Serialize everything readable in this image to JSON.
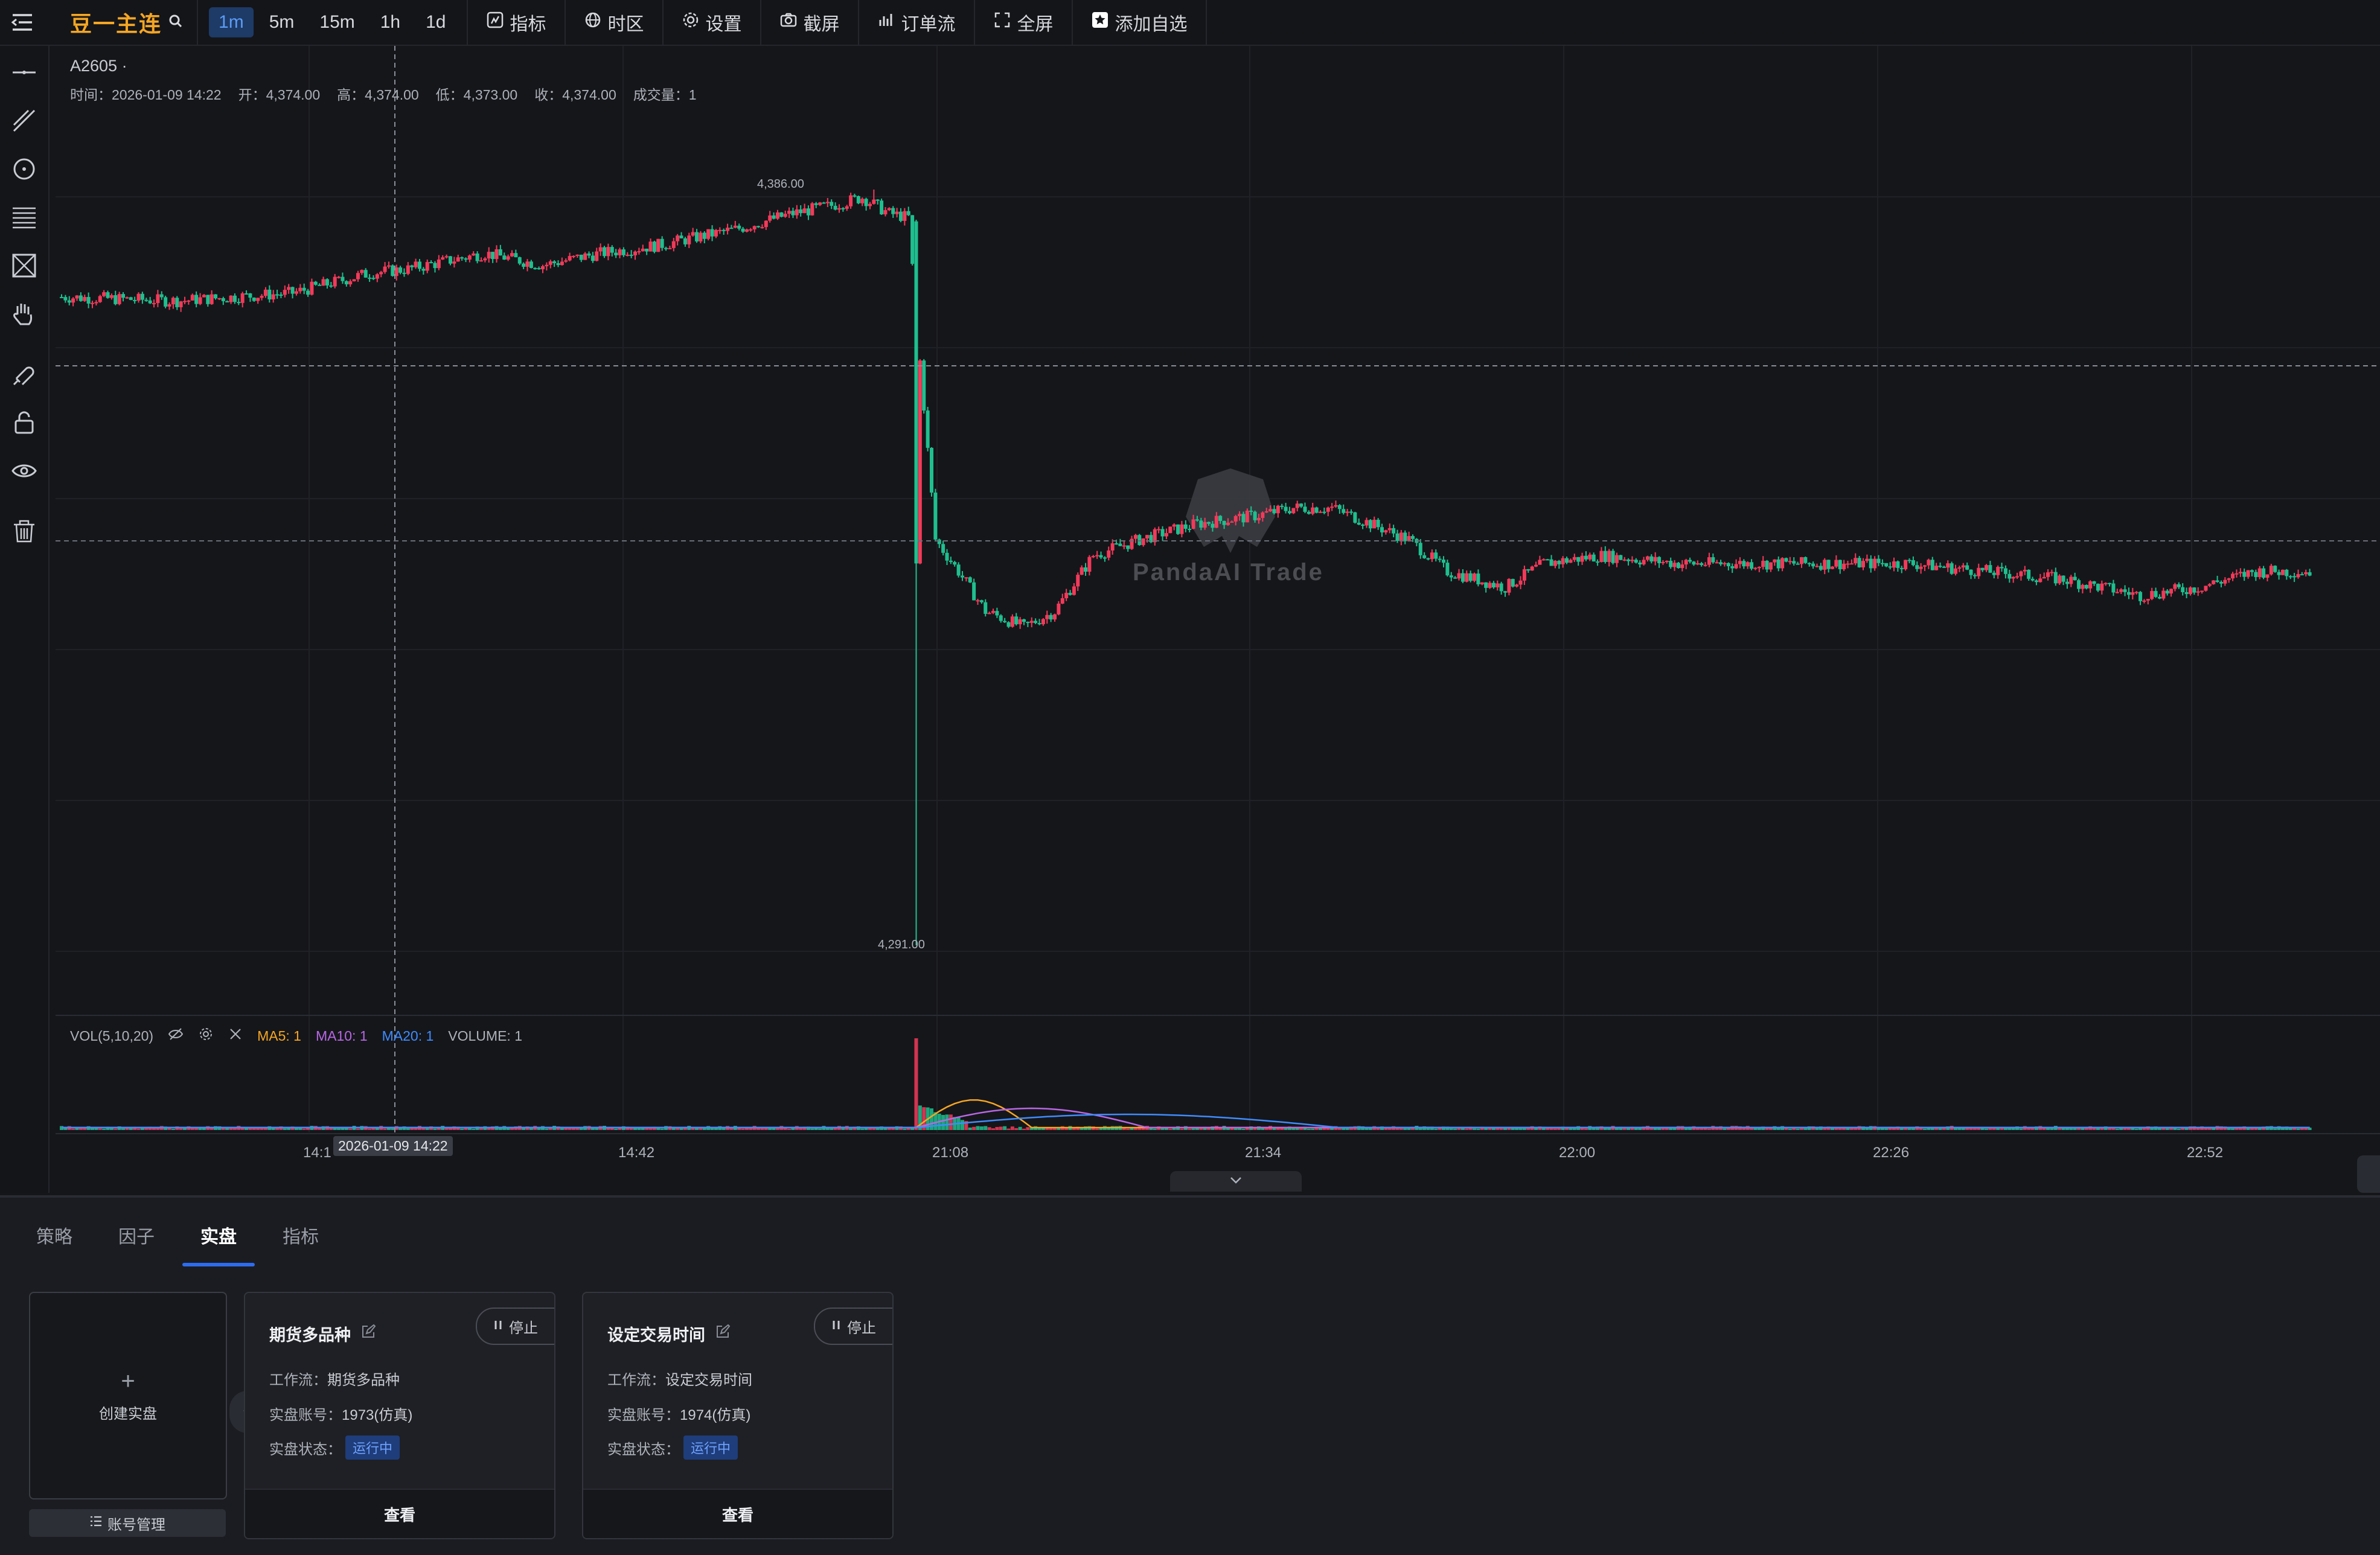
{
  "toolbar": {
    "symbol": "豆一主连",
    "intervals": [
      "1m",
      "5m",
      "15m",
      "1h",
      "1d"
    ],
    "active_interval": "1m",
    "buttons": [
      "指标",
      "时区",
      "设置",
      "截屏",
      "订单流",
      "全屏",
      "添加自选"
    ]
  },
  "chart": {
    "instrument": "A2605 ·",
    "ohlc": {
      "time": "时间：2026-01-09 14:22",
      "open": "开：4,374.00",
      "high": "高：4,374.00",
      "low": "低：4,373.00",
      "close": "收：4,374.00",
      "volume": "成交量：1"
    },
    "high_marker": "4,386.00",
    "low_marker": "4,291.00",
    "watermark": "PandaAI Trade",
    "crosshair_time": "2026-01-09 14:22",
    "x_ticks": [
      "14:1",
      "14:42",
      "21:08",
      "21:34",
      "22:00",
      "22:26",
      "22:52"
    ],
    "vol_legend": {
      "title": "VOL(5,10,20)",
      "ma5": "MA5: 1",
      "ma10": "MA10: 1",
      "ma20": "MA20: 1",
      "volume": "VOLUME: 1"
    },
    "colors": {
      "up": "#f23a5a",
      "down": "#1fbf8f",
      "ma5": "#f5a623",
      "ma10": "#b967e6",
      "ma20": "#3f8cff",
      "accent": "#f5a623"
    }
  },
  "bottom": {
    "tabs": [
      "策略",
      "因子",
      "实盘",
      "指标"
    ],
    "active_tab": "实盘",
    "create_label": "创建实盘",
    "account_button": "账号管理",
    "cards": [
      {
        "title": "期货多品种",
        "stop_label": "停止",
        "workflow_label": "工作流：",
        "workflow": "期货多品种",
        "account_label": "实盘账号：",
        "account": "1973(仿真)",
        "status_label": "实盘状态：",
        "status": "运行中",
        "view_label": "查看"
      },
      {
        "title": "设定交易时间",
        "stop_label": "停止",
        "workflow_label": "工作流：",
        "workflow": "设定交易时间",
        "account_label": "实盘账号：",
        "account": "1974(仿真)",
        "status_label": "实盘状态：",
        "status": "运行中",
        "view_label": "查看"
      }
    ]
  }
}
